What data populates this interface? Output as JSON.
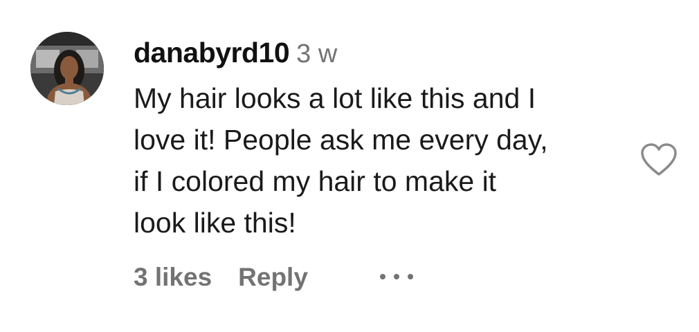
{
  "comment": {
    "username": "danabyrd10",
    "timestamp": "3 w",
    "text_lines": [
      "My hair looks a lot like this and I",
      "love it! People ask me every day,",
      "if I colored my hair to make it",
      "look like this!"
    ],
    "likes": "3 likes",
    "reply_label": "Reply"
  },
  "icons": {
    "like": "heart-outline-icon",
    "more": "more-options-icon",
    "avatar": "profile-photo"
  },
  "colors": {
    "primary_text": "#111111",
    "secondary_text": "#737373",
    "background": "#ffffff"
  }
}
